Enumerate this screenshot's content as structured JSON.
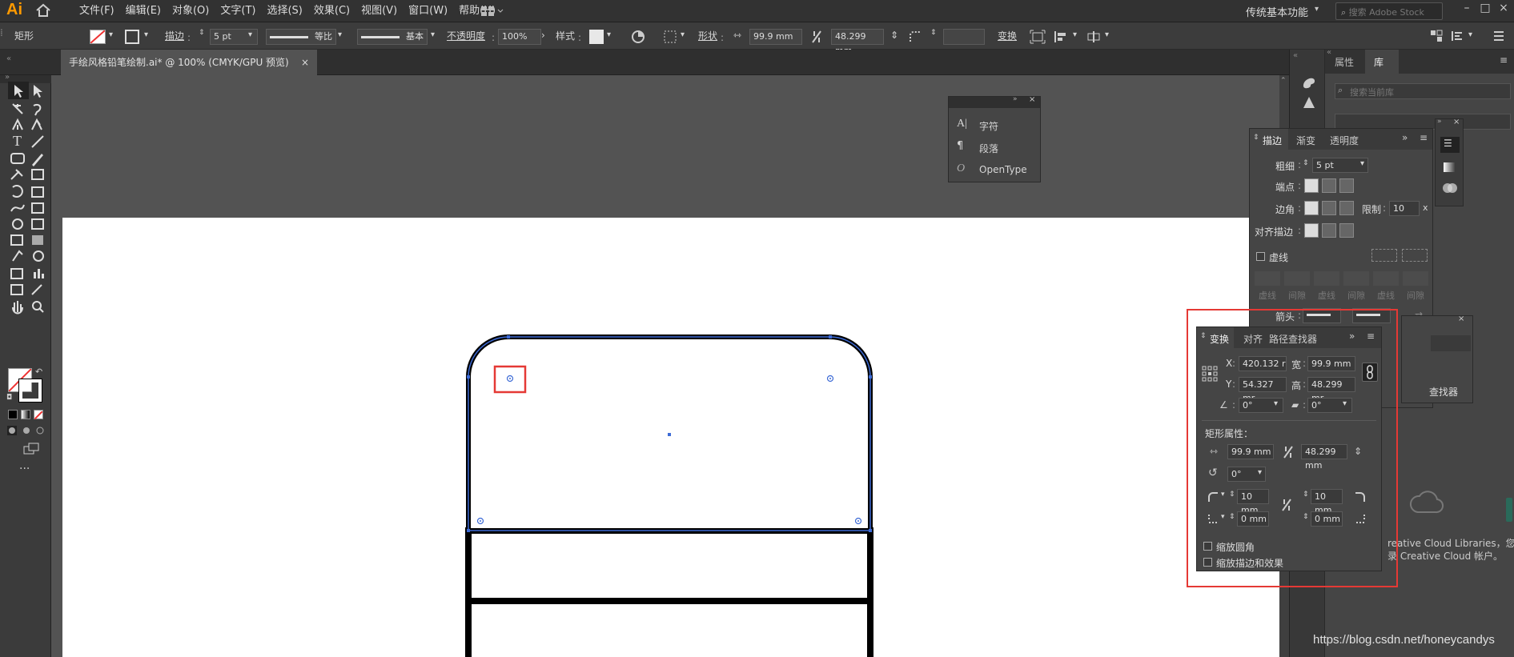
{
  "app": {
    "logo": "Ai"
  },
  "menu": [
    "文件(F)",
    "编辑(E)",
    "对象(O)",
    "文字(T)",
    "选择(S)",
    "效果(C)",
    "视图(V)",
    "窗口(W)",
    "帮助(H)"
  ],
  "workspace": "传统基本功能",
  "search": {
    "placeholder": "搜索 Adobe Stock"
  },
  "control_bar": {
    "object_type": "矩形",
    "stroke_label": "描边",
    "stroke_value": "5 pt",
    "profile_label": "等比",
    "brush_label": "基本",
    "opacity_label": "不透明度",
    "opacity_value": "100%",
    "style_label": "样式",
    "shape_label": "形状",
    "width_value": "99.9 mm",
    "height_value": "48.299 mm",
    "transform_label": "变换"
  },
  "document": {
    "tab_title": "手绘风格铅笔绘制.ai* @ 100% (CMYK/GPU 预览)",
    "close": "×"
  },
  "type_panel": {
    "items": [
      {
        "icon": "character-icon",
        "label": "字符"
      },
      {
        "icon": "paragraph-icon",
        "label": "段落"
      },
      {
        "icon": "opentype-icon",
        "label": "OpenType"
      }
    ]
  },
  "props_panel": {
    "tabs": [
      "属性",
      "库"
    ],
    "search_placeholder": "搜索当前库"
  },
  "stroke_panel": {
    "tabs": [
      "描边",
      "渐变",
      "透明度"
    ],
    "weight_label": "粗细",
    "weight_value": "5 pt",
    "cap_label": "端点",
    "corner_label": "边角",
    "limit_label": "限制",
    "limit_value": "10",
    "limit_unit": "x",
    "align_label": "对齐描边",
    "dashed_label": "虚线",
    "dash_fields": [
      "虚线",
      "间隙",
      "虚线",
      "间隙",
      "虚线",
      "间隙"
    ],
    "arrow_label": "箭头"
  },
  "transform_panel": {
    "tabs": [
      "变换",
      "对齐",
      "路径查找器"
    ],
    "x_label": "X",
    "x_value": "420.132 r",
    "y_label": "Y",
    "y_value": "54.327 mr",
    "w_label": "宽",
    "w_value": "99.9 mm",
    "h_label": "高",
    "h_value": "48.299 mr",
    "angle_value": "0°",
    "shear_value": "0°",
    "rect_props_label": "矩形属性：",
    "rect_w": "99.9 mm",
    "rect_h": "48.299 mm",
    "rect_angle": "0°",
    "corner_tl": "10 mm",
    "corner_tr": "10 mm",
    "corner_bl": "0 mm",
    "corner_br": "0 mm",
    "scale_corners": "缩放圆角",
    "scale_strokes": "缩放描边和效果"
  },
  "libraries": {
    "text_line1": "reative Cloud Libraries，您",
    "text_line2": "录 Creative Cloud 帐户。",
    "pathfinder_partial": "查找器"
  },
  "watermark": "https://blog.csdn.net/honeycandys",
  "colors": {
    "accent_blue": "#3d6bd6",
    "highlight_red": "#e53935",
    "logo_orange": "#ff9a00"
  }
}
